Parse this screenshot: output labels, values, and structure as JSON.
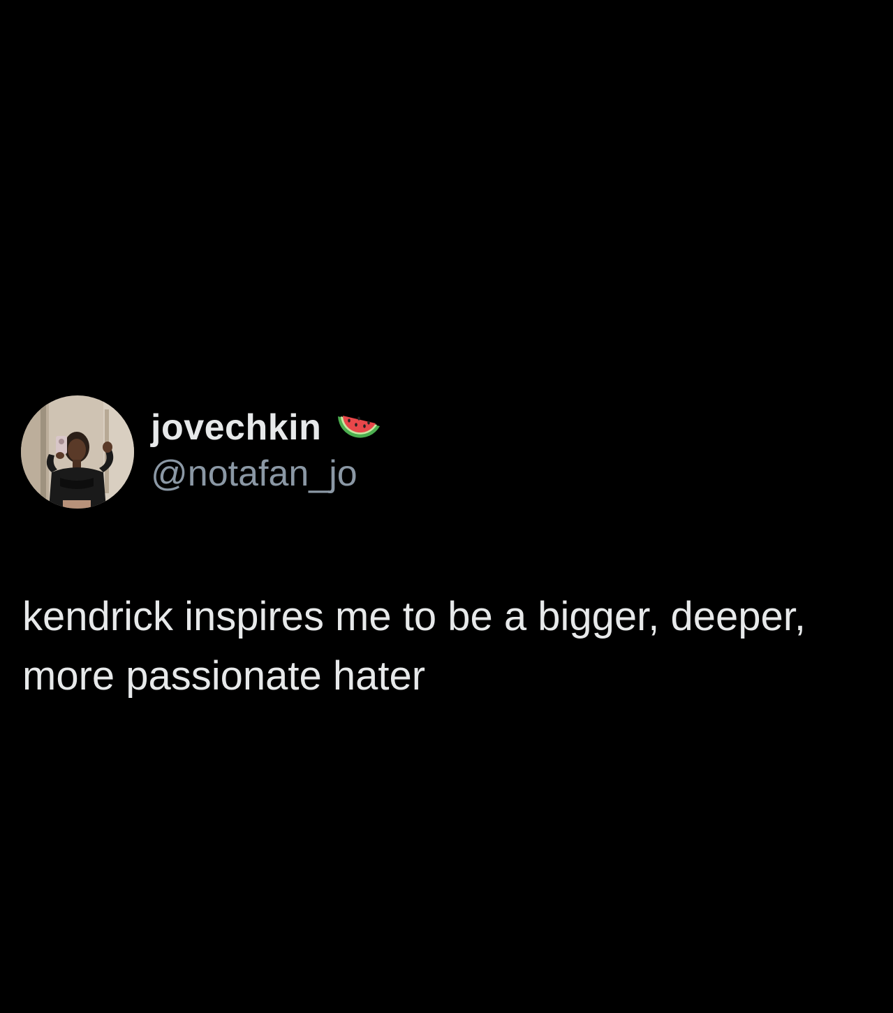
{
  "tweet": {
    "display_name": "jovechkin",
    "name_emoji": "watermelon-icon",
    "handle": "@notafan_jo",
    "text": "kendrick inspires me to be a bigger, deeper, more passionate hater"
  },
  "colors": {
    "background": "#000000",
    "primary_text": "#e7e9ea",
    "secondary_text": "#8b98a5"
  }
}
